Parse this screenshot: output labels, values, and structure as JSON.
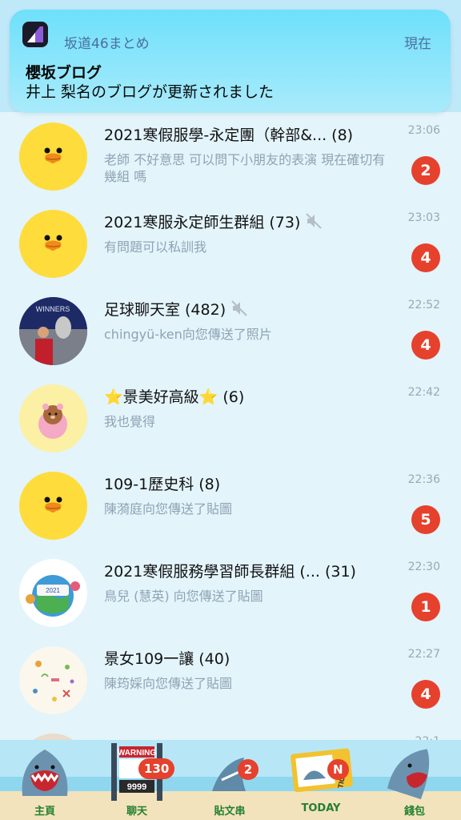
{
  "notification": {
    "app_name": "坂道46まとめ",
    "time": "現在",
    "title": "櫻坂ブログ",
    "body": "井上 梨名のブログが更新されました"
  },
  "chats": [
    {
      "name": "2021寒假服學-永定團（幹部&...",
      "count": "(8)",
      "muted": false,
      "preview": "老師 不好意思 可以問下小朋友的表演 現在確切有幾組 嗎",
      "time": "23:06",
      "unread": "2",
      "avatar": "sally"
    },
    {
      "name": "2021寒服永定師生群組",
      "count": "(73)",
      "muted": true,
      "preview": "有問題可以私訓我",
      "time": "23:03",
      "unread": "4",
      "avatar": "sally"
    },
    {
      "name": "足球聊天室",
      "count": "(482)",
      "muted": true,
      "preview": "chingyü-ken向您傳送了照片",
      "time": "22:52",
      "unread": "4",
      "avatar": "photo"
    },
    {
      "name": "⭐景美好高級⭐",
      "count": "(6)",
      "muted": false,
      "preview": "我也覺得",
      "time": "22:42",
      "unread": "",
      "avatar": "brown-pig"
    },
    {
      "name": "109-1歷史科",
      "count": "(8)",
      "muted": false,
      "preview": "陳漪庭向您傳送了貼圖",
      "time": "22:36",
      "unread": "5",
      "avatar": "sally"
    },
    {
      "name": "2021寒假服務學習師長群組 (...",
      "count": "(31)",
      "muted": false,
      "preview": "鳥兒 (慧英) 向您傳送了貼圖",
      "time": "22:30",
      "unread": "1",
      "avatar": "badge-2021"
    },
    {
      "name": "景女109一讓",
      "count": "(40)",
      "muted": false,
      "preview": "陳筠婇向您傳送了貼圖",
      "time": "22:27",
      "unread": "4",
      "avatar": "pattern"
    }
  ],
  "partial_row": {
    "time": "22:1"
  },
  "bottom_nav": [
    {
      "label": "主頁",
      "icon": "home-shark-icon",
      "badge": ""
    },
    {
      "label": "聊天",
      "icon": "chat-sign-icon",
      "badge": "130",
      "sign_top": "WARNING",
      "sign_bottom": "9999"
    },
    {
      "label": "貼文串",
      "icon": "shark-fin-icon",
      "badge": "2"
    },
    {
      "label": "TODAY",
      "icon": "ticket-icon",
      "badge": "N",
      "ticket_text": "TICKET"
    },
    {
      "label": "錢包",
      "icon": "wallet-shark-icon",
      "badge": ""
    }
  ],
  "colors": {
    "badge": "#e5412d",
    "nav_label": "#238030",
    "background": "#e3f4fb",
    "sally": "#fedc3b"
  }
}
